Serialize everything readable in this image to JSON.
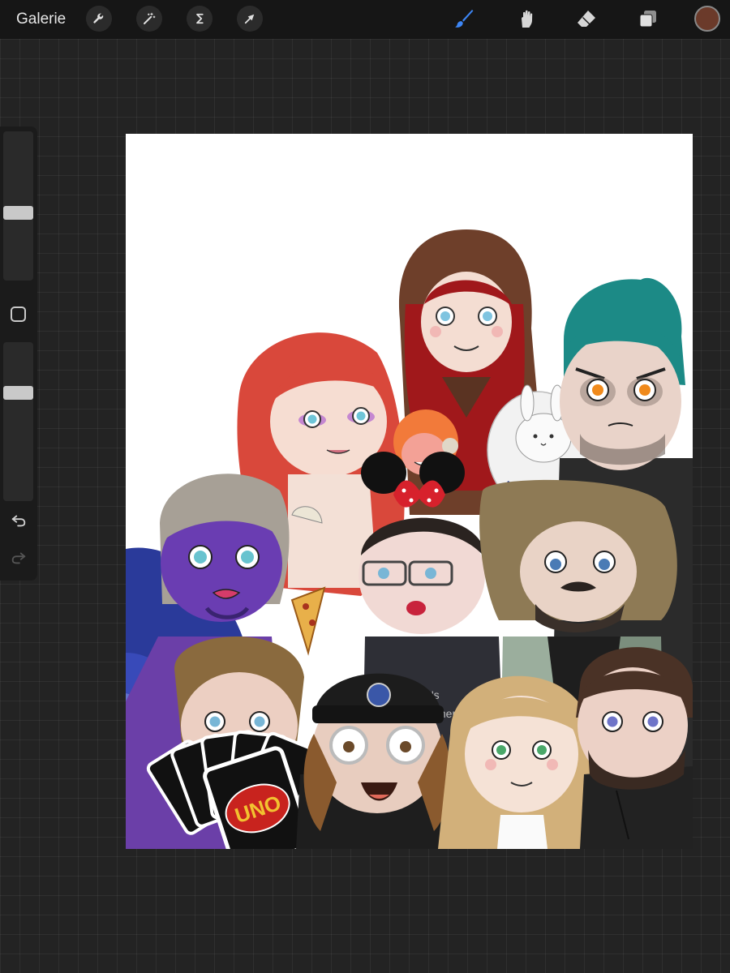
{
  "topbar": {
    "gallery_label": "Galerie",
    "left_tools": [
      "wrench-icon",
      "magic-wand-icon",
      "selection-s-icon",
      "arrow-transform-icon"
    ],
    "right_tools": [
      "brush-icon",
      "smudge-icon",
      "eraser-icon",
      "layers-icon"
    ],
    "active_tool": "brush",
    "accent_color": "#3d86f5",
    "current_color": "#6b3a2a"
  },
  "sidebar": {
    "brush_size_level": 0.45,
    "opacity_level": 0.7,
    "icons": [
      "modify-square-icon",
      "undo-icon",
      "redo-icon"
    ]
  },
  "canvas": {
    "card_text": "UNO",
    "shirt_text_1": "y's",
    "shirt_text_2": "mer"
  }
}
